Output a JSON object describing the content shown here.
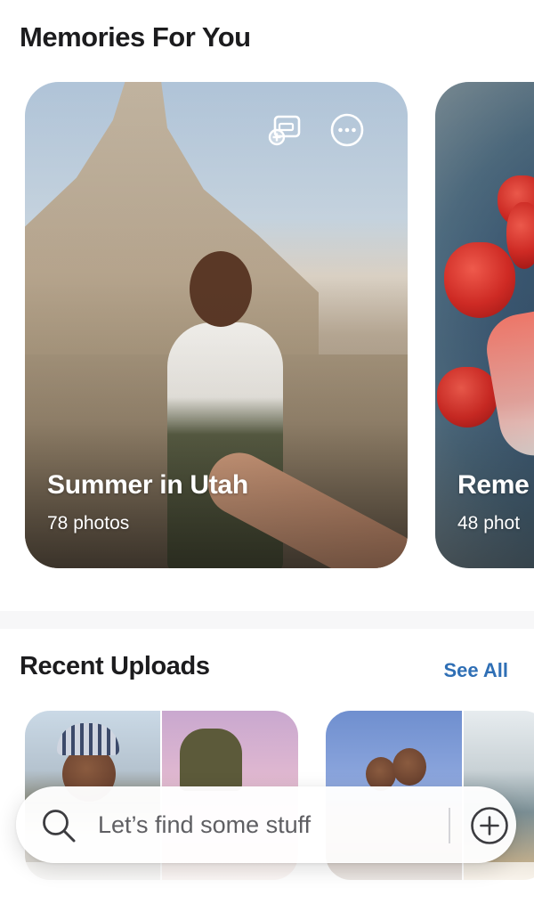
{
  "memories": {
    "section_title": "Memories For You",
    "cards": [
      {
        "title": "Summer in Utah",
        "subtitle": "78 photos",
        "image": "woman-leading-hand-in-desert-photo"
      },
      {
        "title": "Reme",
        "subtitle": "48 phot",
        "image": "strawberries-and-popsicle-photo"
      }
    ],
    "actions": {
      "add_to_album_icon": "add-to-album-icon",
      "more_icon": "more-options-icon"
    }
  },
  "recent_uploads": {
    "section_title": "Recent Uploads",
    "see_all_label": "See All"
  },
  "search": {
    "placeholder": "Let’s find some stuff",
    "value": "",
    "search_icon": "search-icon",
    "add_icon": "add-circle-icon"
  },
  "colors": {
    "accent": "#2f6fb5",
    "background": "#f7f7f8",
    "card_text": "#ffffff"
  }
}
